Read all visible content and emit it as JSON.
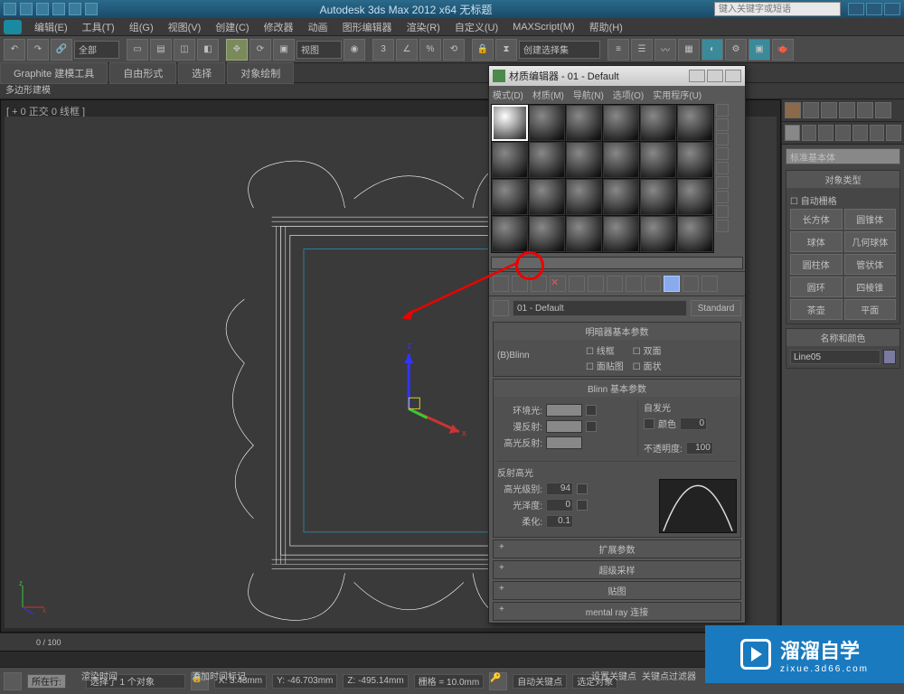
{
  "titlebar": {
    "app_title": "Autodesk 3ds Max 2012 x64   无标题",
    "search_placeholder": "键入关键字或短语"
  },
  "menu": [
    "编辑(E)",
    "工具(T)",
    "组(G)",
    "视图(V)",
    "创建(C)",
    "修改器",
    "动画",
    "图形编辑器",
    "渲染(R)",
    "自定义(U)",
    "MAXScript(M)",
    "帮助(H)"
  ],
  "maintoolbar_dd1": "全部",
  "maintoolbar_dd2": "视图",
  "maintoolbar_dd3": "创建选择集",
  "ribbon": {
    "tabs": [
      "Graphite 建模工具",
      "自由形式",
      "选择",
      "对象绘制"
    ],
    "subrow": "多边形建模"
  },
  "viewport": {
    "label": "[ + 0 正交 0 线框 ]"
  },
  "mat_editor": {
    "title": "材质编辑器 - 01 - Default",
    "menu": [
      "模式(D)",
      "材质(M)",
      "导航(N)",
      "选项(O)",
      "实用程序(U)"
    ],
    "name": "01 - Default",
    "type_btn": "Standard",
    "shader_rollout": "明暗器基本参数",
    "shader_dd": "(B)Blinn",
    "shader_chk": {
      "wire": "线框",
      "two": "双面",
      "facemap": "面贴图",
      "faceted": "面状"
    },
    "blinn_rollout": "Blinn 基本参数",
    "selfillum": "自发光",
    "color_chk": "颜色",
    "ambient": "环境光:",
    "diffuse": "漫反射:",
    "specular": "高光反射:",
    "opacity": "不透明度:",
    "opacity_val": "100",
    "selfillum_val": "0",
    "spec_section": "反射高光",
    "spec_level": "高光级别:",
    "spec_level_val": "94",
    "gloss": "光泽度:",
    "gloss_val": "0",
    "soften": "柔化:",
    "soften_val": "0.1",
    "subrollouts": [
      "扩展参数",
      "超级采样",
      "贴图",
      "mental ray 连接"
    ]
  },
  "command_panel": {
    "dd": "标准基本体",
    "rollout1": "对象类型",
    "autogird": "自动栅格",
    "buttons": [
      "长方体",
      "圆锥体",
      "球体",
      "几何球体",
      "圆柱体",
      "管状体",
      "圆环",
      "四棱锥",
      "茶壶",
      "平面"
    ],
    "rollout2": "名称和颜色",
    "name_val": "Line05"
  },
  "timeslider": {
    "label": "0 / 100"
  },
  "status": {
    "sel_text": "选择了 1 个对象",
    "x": "X: 3.48mm",
    "y": "Y: -46.703mm",
    "z": "Z: -495.14mm",
    "grid": "栅格 = 10.0mm",
    "autokey": "自动关键点",
    "setkey": "设置关键点",
    "selset": "选定对象",
    "keyfilter": "关键点过滤器",
    "addtime": "添加时间标记",
    "render": "渲染时间",
    "row_label": "所在行:"
  },
  "watermark": {
    "main": "溜溜自学",
    "sub": "zixue.3d66.com"
  }
}
